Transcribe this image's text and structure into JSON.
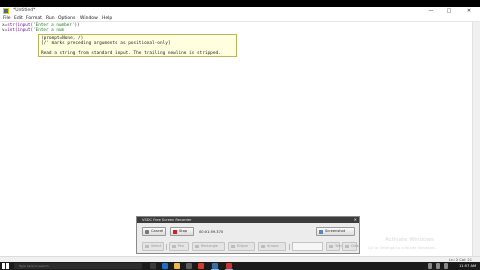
{
  "idle": {
    "title": "*Untitled*",
    "window_controls": {
      "minimize": "—",
      "maximize": "□",
      "close": "✕"
    },
    "menu": [
      "File",
      "Edit",
      "Format",
      "Run",
      "Options",
      "Window",
      "Help"
    ],
    "code_lines": [
      {
        "var": "x",
        "op": "=",
        "func": "str(input(",
        "arg": "'Enter a number'",
        "close": "))"
      },
      {
        "var": "v",
        "op": "=",
        "func": "int(input(",
        "arg": "'Enter a num",
        "close": ""
      }
    ],
    "status": "Ln: 2   Col: 21"
  },
  "calltip": {
    "signature": "(prompt=None, /)",
    "note": "[/' marks preceding arguments as positional-only]",
    "doc": "Read a string from standard input.  The trailing newline is stripped."
  },
  "recorder": {
    "title": "VSDC Free Screen Recorder",
    "close": "✕",
    "cancel_label": "Cancel",
    "stop_label": "Stop",
    "info": "00:01:59.370",
    "screenshot_label": "Screenshot",
    "tools": [
      "Select",
      "Pen",
      "Rectangle",
      "Ellipse",
      "Arrows",
      "Text",
      "Clear"
    ]
  },
  "watermark": {
    "line1": "Activate Windows",
    "line2": "Go to Settings to activate Windows."
  },
  "taskbar": {
    "search_placeholder": "Type here to search",
    "clock": "11:57 AM"
  },
  "colors": {
    "calltip_bg": "#ffffe0",
    "keyword": "#7a00aa",
    "string": "#1a7a1a",
    "taskbar_bg": "#1b1b1b",
    "recorder_record": "#d22020"
  }
}
